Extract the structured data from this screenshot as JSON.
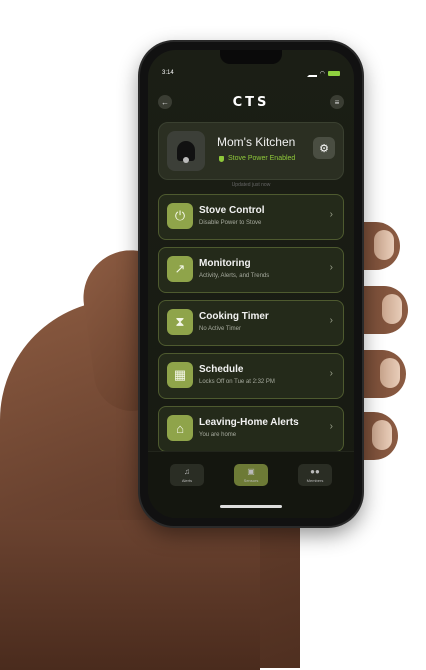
{
  "status_bar": {
    "time": "3:14"
  },
  "header": {
    "logo": "CTS"
  },
  "kitchen": {
    "title": "Mom's Kitchen",
    "status": "Stove Power Enabled",
    "updated": "Updated just now"
  },
  "menu": [
    {
      "title": "Stove Control",
      "subtitle": "Disable Power to Stove",
      "icon": "power-icon"
    },
    {
      "title": "Monitoring",
      "subtitle": "Activity, Alerts, and Trends",
      "icon": "trend-icon"
    },
    {
      "title": "Cooking Timer",
      "subtitle": "No Active Timer",
      "icon": "hourglass-icon"
    },
    {
      "title": "Schedule",
      "subtitle": "Locks Off on Tue at 2:32 PM",
      "icon": "calendar-icon"
    },
    {
      "title": "Leaving-Home Alerts",
      "subtitle": "You are home",
      "icon": "home-icon"
    }
  ],
  "tabs": [
    {
      "label": "Alerts"
    },
    {
      "label": "Sensors",
      "active": true
    },
    {
      "label": "Members"
    }
  ],
  "colors": {
    "accent": "#8fa44a",
    "status_green": "#8fc93a",
    "background": "#1b1e15"
  }
}
